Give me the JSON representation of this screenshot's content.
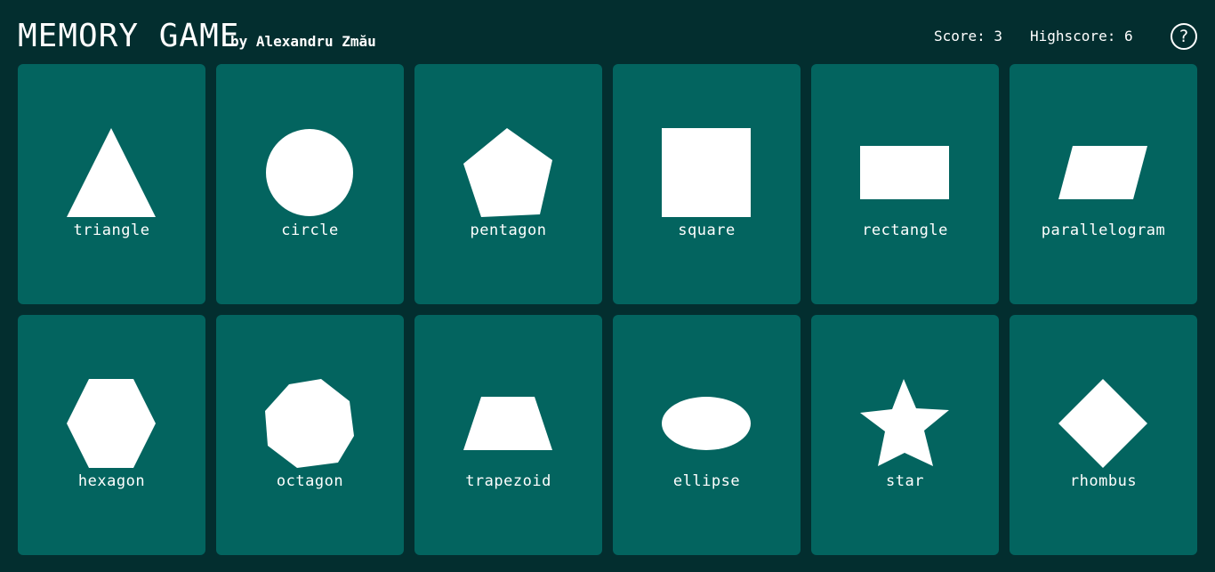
{
  "header": {
    "title": "MEMORY GAME",
    "author": "by Alexandru Zmău",
    "score": "Score: 3",
    "highscore": "Highscore: 6",
    "help_icon": "question-circle-icon",
    "help_text": "?"
  },
  "colors": {
    "background": "#032e2f",
    "card": "#03645f",
    "shape": "#ffffff",
    "text": "#ffffff"
  },
  "cards": [
    {
      "label": "triangle",
      "icon": "triangle-icon"
    },
    {
      "label": "circle",
      "icon": "circle-icon"
    },
    {
      "label": "pentagon",
      "icon": "pentagon-icon"
    },
    {
      "label": "square",
      "icon": "square-icon"
    },
    {
      "label": "rectangle",
      "icon": "rectangle-icon"
    },
    {
      "label": "parallelogram",
      "icon": "parallelogram-icon"
    },
    {
      "label": "hexagon",
      "icon": "hexagon-icon"
    },
    {
      "label": "octagon",
      "icon": "octagon-icon"
    },
    {
      "label": "trapezoid",
      "icon": "trapezoid-icon"
    },
    {
      "label": "ellipse",
      "icon": "ellipse-icon"
    },
    {
      "label": "star",
      "icon": "star-icon"
    },
    {
      "label": "rhombus",
      "icon": "rhombus-icon"
    }
  ]
}
